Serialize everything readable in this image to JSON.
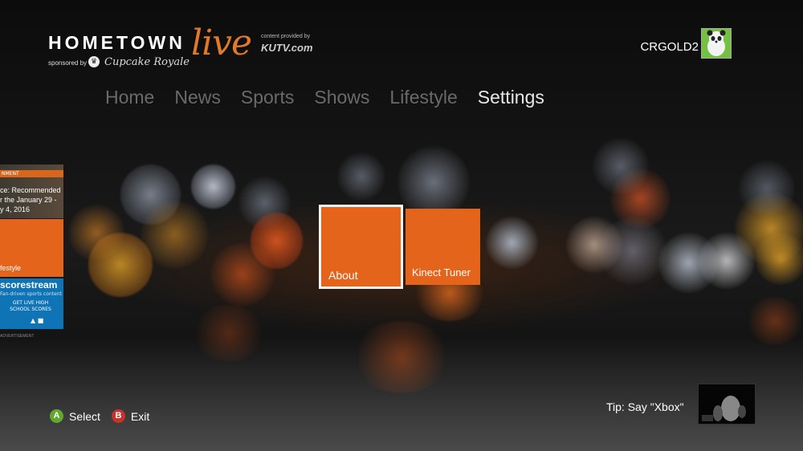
{
  "logo": {
    "hometown": "HOMETOWN",
    "live": "live",
    "provided": "content provided by",
    "kutv": "KUTV.com",
    "sponsored": "sponsored by",
    "sponsor_name": "Cupcake Royale"
  },
  "user": {
    "gamertag": "CRGOLD2"
  },
  "nav": {
    "items": [
      {
        "label": "Home"
      },
      {
        "label": "News"
      },
      {
        "label": "Sports"
      },
      {
        "label": "Shows"
      },
      {
        "label": "Lifestyle"
      },
      {
        "label": "Settings"
      }
    ],
    "active": "Settings"
  },
  "left_panel": {
    "news_tag": "NMENT",
    "news_text_1": "ce: Recommended",
    "news_text_2": "r the January 29 -",
    "news_text_3": "y 4, 2016",
    "lifestyle": "festyle",
    "ad_brand": "scorestream",
    "ad_sub": "Fan-driven sports content",
    "ad_cta": "GET LIVE HIGH SCHOOL SCORES",
    "ad_label": "ADVERTISEMENT"
  },
  "tiles": {
    "about": "About",
    "kinect_tuner": "Kinect Tuner"
  },
  "footer": {
    "a_glyph": "A",
    "select": "Select",
    "b_glyph": "B",
    "exit": "Exit",
    "tip": "Tip: Say \"Xbox\""
  },
  "colors": {
    "accent": "#e5641c",
    "nav_inactive": "#6a6a6a",
    "nav_active": "#e8e8e8",
    "button_a": "#63a82e",
    "button_b": "#c7332a"
  }
}
